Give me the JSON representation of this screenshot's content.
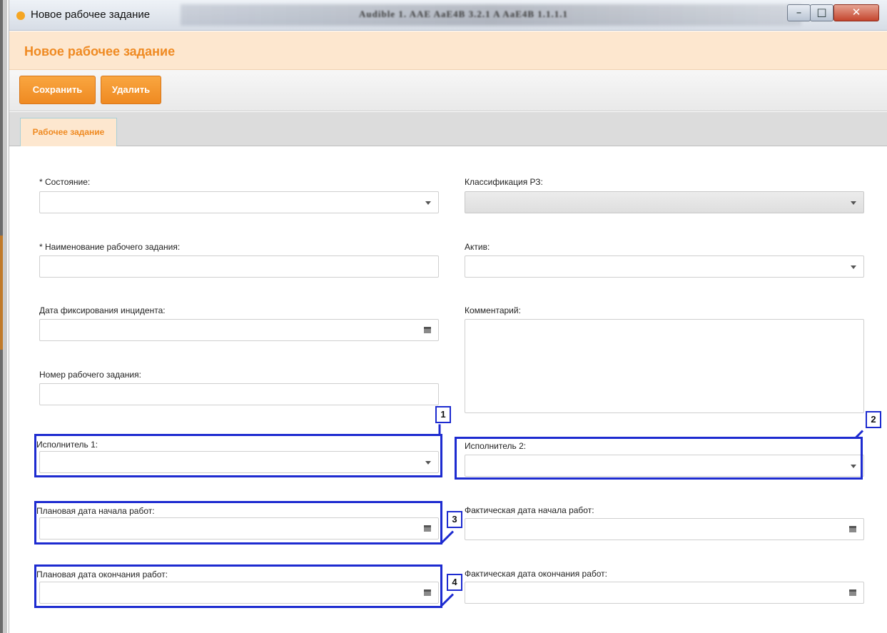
{
  "window": {
    "title": "Новое рабочее задание",
    "blurred_caption": "Audible 1. AAE AaE4B 3.2.1 A AaE4B 1.1.1.1"
  },
  "header": {
    "title": "Новое рабочее задание"
  },
  "toolbar": {
    "save_label": "Сохранить",
    "delete_label": "Удалить"
  },
  "tabs": [
    {
      "label": "Рабочее задание",
      "active": true
    }
  ],
  "form": {
    "state": {
      "label": "* Состояние:",
      "value": ""
    },
    "classification": {
      "label": "Классификация РЗ:",
      "value": "",
      "disabled": true
    },
    "name": {
      "label": "* Наименование рабочего задания:",
      "value": ""
    },
    "asset": {
      "label": "Актив:",
      "value": ""
    },
    "incident_date": {
      "label": "Дата фиксирования инцидента:",
      "value": ""
    },
    "comment": {
      "label": "Комментарий:",
      "value": ""
    },
    "number": {
      "label": "Номер рабочего задания:",
      "value": ""
    },
    "executor1": {
      "label": "Исполнитель 1:",
      "value": ""
    },
    "executor2": {
      "label": "Исполнитель 2:",
      "value": ""
    },
    "plan_start": {
      "label": "Плановая дата начала работ:",
      "value": ""
    },
    "fact_start": {
      "label": "Фактическая дата начала работ:",
      "value": ""
    },
    "plan_end": {
      "label": "Плановая дата окончания работ:",
      "value": ""
    },
    "fact_end": {
      "label": "Фактическая дата окончания работ:",
      "value": ""
    }
  },
  "annotations": [
    "1",
    "2",
    "3",
    "4"
  ],
  "colors": {
    "accent": "#ef8a22",
    "header_bg": "#fde7cf",
    "highlight": "#1d2bd0"
  },
  "icons": {
    "dropdown": "chevron-down-icon",
    "calendar": "calendar-icon"
  }
}
